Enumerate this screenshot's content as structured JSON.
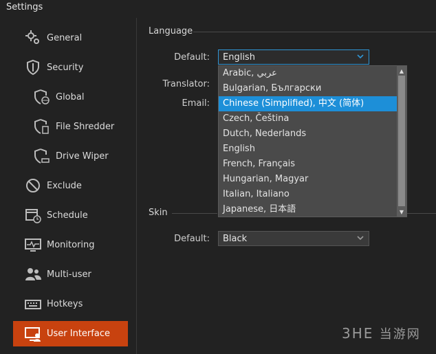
{
  "window": {
    "title": "Settings"
  },
  "sidebar": {
    "items": [
      {
        "label": "General"
      },
      {
        "label": "Security"
      },
      {
        "label": "Global"
      },
      {
        "label": "File Shredder"
      },
      {
        "label": "Drive Wiper"
      },
      {
        "label": "Exclude"
      },
      {
        "label": "Schedule"
      },
      {
        "label": "Monitoring"
      },
      {
        "label": "Multi-user"
      },
      {
        "label": "Hotkeys"
      },
      {
        "label": "User Interface"
      }
    ],
    "active": "User Interface",
    "active_color": "#c8420f"
  },
  "language": {
    "section_label": "Language",
    "default_label": "Default:",
    "default_value": "English",
    "translator_label": "Translator:",
    "email_label": "Email:",
    "options": [
      "Arabic, عربي",
      "Bulgarian, Български",
      "Chinese (Simplified), 中文 (简体)",
      "Czech, Čeština",
      "Dutch, Nederlands",
      "English",
      "French, Français",
      "Hungarian, Magyar",
      "Italian, Italiano",
      "Japanese, 日本語"
    ],
    "highlighted_option": "Chinese (Simplified), 中文 (简体)",
    "highlight_color": "#1d8fd8"
  },
  "skin": {
    "section_label": "Skin",
    "default_label": "Default:",
    "default_value": "Black"
  },
  "watermark": {
    "brand": "3HE",
    "cn": "当游网"
  }
}
